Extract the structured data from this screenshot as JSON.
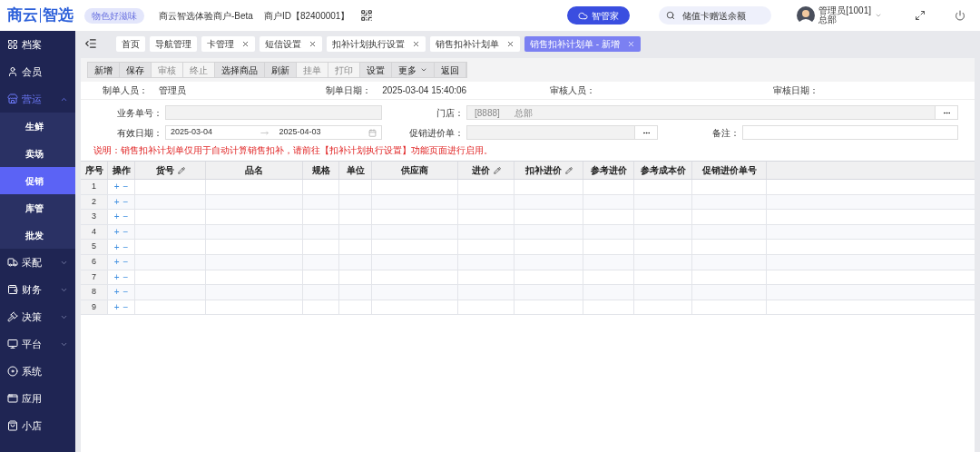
{
  "header": {
    "logo": [
      "商云",
      "智选"
    ],
    "slogan": "物色好滋味",
    "merchant": "商云智选体验商户-Beta",
    "merchant_id": "商户ID【82400001】",
    "assistant_button": "智管家",
    "search": {
      "value": "储值卡赠送余额"
    },
    "user": {
      "name": "管理员[1001]",
      "org": "总部"
    }
  },
  "sidebar": {
    "items": [
      {
        "label": "档案",
        "expandable": false,
        "expanded": false
      },
      {
        "label": "会员",
        "expandable": false,
        "expanded": false
      },
      {
        "label": "营运",
        "expandable": true,
        "expanded": true,
        "children": [
          {
            "label": "生鲜",
            "selected": false
          },
          {
            "label": "卖场",
            "selected": false
          },
          {
            "label": "促销",
            "selected": true
          },
          {
            "label": "库管",
            "selected": false
          },
          {
            "label": "批发",
            "selected": false
          }
        ]
      },
      {
        "label": "采配",
        "expandable": true,
        "expanded": false
      },
      {
        "label": "财务",
        "expandable": true,
        "expanded": false
      },
      {
        "label": "决策",
        "expandable": true,
        "expanded": false
      },
      {
        "label": "平台",
        "expandable": true,
        "expanded": false
      },
      {
        "label": "系统",
        "expandable": false,
        "expanded": false
      },
      {
        "label": "应用",
        "expandable": false,
        "expanded": false
      },
      {
        "label": "小店",
        "expandable": false,
        "expanded": false
      }
    ]
  },
  "tabs": [
    {
      "label": "首页",
      "closable": false,
      "selected": false
    },
    {
      "label": "导航管理",
      "closable": false,
      "selected": false
    },
    {
      "label": "卡管理",
      "closable": true,
      "selected": false
    },
    {
      "label": "短信设置",
      "closable": true,
      "selected": false
    },
    {
      "label": "扣补计划执行设置",
      "closable": true,
      "selected": false
    },
    {
      "label": "销售扣补计划单",
      "closable": true,
      "selected": false
    },
    {
      "label": "销售扣补计划单 - 新增",
      "closable": true,
      "selected": true
    }
  ],
  "toolbar": [
    {
      "label": "新增",
      "disabled": false,
      "dropdown": false
    },
    {
      "label": "保存",
      "disabled": false,
      "dropdown": false
    },
    {
      "label": "审核",
      "disabled": true,
      "dropdown": false
    },
    {
      "label": "终止",
      "disabled": true,
      "dropdown": false
    },
    {
      "label": "选择商品",
      "disabled": false,
      "dropdown": false
    },
    {
      "label": "刷新",
      "disabled": false,
      "dropdown": false
    },
    {
      "label": "挂单",
      "disabled": true,
      "dropdown": false
    },
    {
      "label": "打印",
      "disabled": true,
      "dropdown": false
    },
    {
      "label": "设置",
      "disabled": false,
      "dropdown": false
    },
    {
      "label": "更多",
      "disabled": false,
      "dropdown": true
    },
    {
      "label": "返回",
      "disabled": false,
      "dropdown": false
    }
  ],
  "info": [
    {
      "label": "制单人员：",
      "value": "管理员"
    },
    {
      "label": "制单日期：",
      "value": "2025-03-04 15:40:06"
    },
    {
      "label": "审核人员："
    },
    {
      "label": "审核日期："
    }
  ],
  "form": {
    "order_no": {
      "label": "业务单号："
    },
    "store": {
      "label": "门店：",
      "code": "[8888]",
      "name": "总部"
    },
    "valid_date": {
      "label": "有效日期：",
      "start": "2025-03-04",
      "end": "2025-04-03"
    },
    "promo_order": {
      "label": "促销进价单："
    },
    "remark": {
      "label": "备注："
    }
  },
  "note": "说明：销售扣补计划单仅用于自动计算销售扣补，请前往【扣补计划执行设置】功能页面进行启用。",
  "table": {
    "columns": [
      {
        "label": "序号",
        "editable": false
      },
      {
        "label": "操作",
        "editable": false
      },
      {
        "label": "货号",
        "editable": true
      },
      {
        "label": "品名",
        "editable": false
      },
      {
        "label": "规格",
        "editable": false
      },
      {
        "label": "单位",
        "editable": false
      },
      {
        "label": "供应商",
        "editable": false
      },
      {
        "label": "进价",
        "editable": true
      },
      {
        "label": "扣补进价",
        "editable": true
      },
      {
        "label": "参考进价",
        "editable": false
      },
      {
        "label": "参考成本价",
        "editable": false
      },
      {
        "label": "促销进价单号",
        "editable": false
      }
    ],
    "rows": [
      {
        "index": "1",
        "add": "+",
        "remove": "−"
      },
      {
        "index": "2",
        "add": "+",
        "remove": "−"
      },
      {
        "index": "3",
        "add": "+",
        "remove": "−"
      },
      {
        "index": "4",
        "add": "+",
        "remove": "−"
      },
      {
        "index": "5",
        "add": "+",
        "remove": "−"
      },
      {
        "index": "6",
        "add": "+",
        "remove": "−"
      },
      {
        "index": "7",
        "add": "+",
        "remove": "−"
      },
      {
        "index": "8",
        "add": "+",
        "remove": "−"
      },
      {
        "index": "9",
        "add": "+",
        "remove": "−"
      }
    ]
  }
}
